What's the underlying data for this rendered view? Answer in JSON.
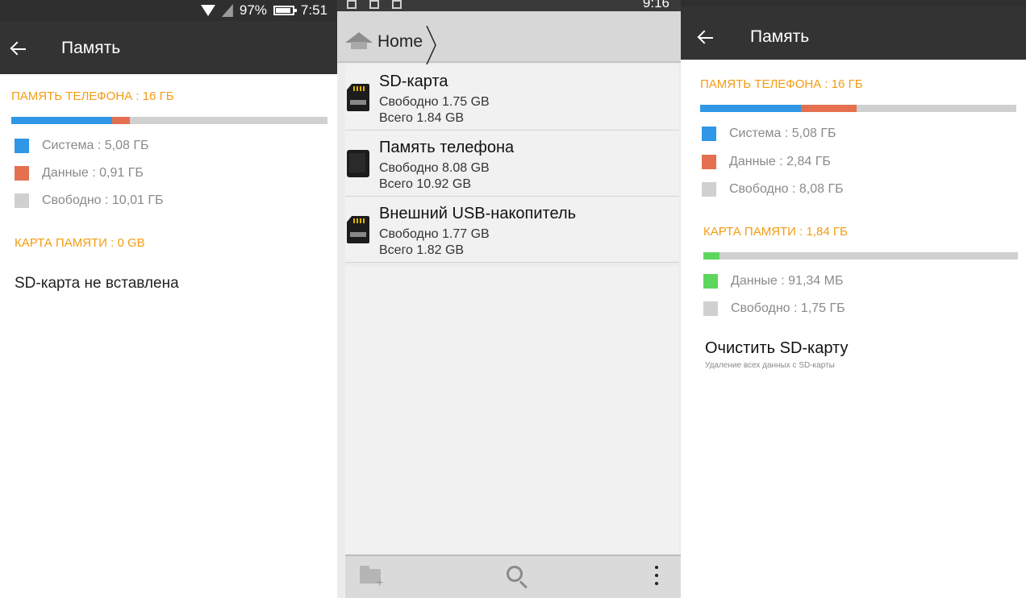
{
  "left": {
    "status": {
      "battery_pct": "97%",
      "time": "7:51"
    },
    "appbar": {
      "title": "Память"
    },
    "phone_memory": {
      "header": "ПАМЯТЬ ТЕЛЕФОНА : 16 ГБ",
      "usage_fractions": {
        "system": 0.318,
        "data": 0.057,
        "free": 0.625
      },
      "legend": [
        {
          "label": "Система : 5,08 ГБ",
          "color": "#2f97e6"
        },
        {
          "label": "Данные : 0,91 ГБ",
          "color": "#e4704f"
        },
        {
          "label": "Свободно : 10,01 ГБ",
          "color": "#d0d0d0"
        }
      ]
    },
    "sd_card": {
      "header": "КАРТА ПАМЯТИ : 0 GB",
      "message": "SD-карта не вставлена"
    }
  },
  "middle": {
    "status": {
      "time_fragment": "9:16"
    },
    "breadcrumb": {
      "home_label": "Home"
    },
    "drives": [
      {
        "title": "SD-карта",
        "free": "Свободно 1.75 GB",
        "total": "Всего 1.84 GB",
        "icon": "sd-card-icon"
      },
      {
        "title": "Память телефона",
        "free": "Свободно 8.08 GB",
        "total": "Всего 10.92 GB",
        "icon": "phone-icon"
      },
      {
        "title": "Внешний USB-накопитель",
        "free": "Свободно 1.77 GB",
        "total": "Всего 1.82 GB",
        "icon": "sd-card-icon"
      }
    ],
    "toolbar": {
      "icons": [
        "new-folder-icon",
        "search-icon",
        "more-vert-icon"
      ]
    }
  },
  "right": {
    "appbar": {
      "title": "Память"
    },
    "phone_memory": {
      "header": "ПАМЯТЬ ТЕЛЕФОНА : 16 ГБ",
      "usage_fractions": {
        "system": 0.318,
        "data": 0.178,
        "free": 0.504
      },
      "legend": [
        {
          "label": "Система : 5,08 ГБ",
          "color": "#2f97e6"
        },
        {
          "label": "Данные : 2,84 ГБ",
          "color": "#e4704f"
        },
        {
          "label": "Свободно : 8,08 ГБ",
          "color": "#d0d0d0"
        }
      ]
    },
    "sd_card": {
      "header": "КАРТА ПАМЯТИ : 1,84 ГБ",
      "usage_fractions": {
        "data": 0.05,
        "free": 0.95
      },
      "legend": [
        {
          "label": "Данные : 91,34 МБ",
          "color": "#5cd65c"
        },
        {
          "label": "Свободно : 1,75 ГБ",
          "color": "#d0d0d0"
        }
      ]
    },
    "action": {
      "title": "Очистить SD-карту",
      "subtitle": "Удаление всех данных с SD-карты"
    }
  },
  "colors": {
    "accent": "#f39c12",
    "appbar": "#333333",
    "system": "#2f97e6",
    "data": "#e4704f",
    "sd_data": "#5cd65c",
    "free": "#d0d0d0"
  }
}
